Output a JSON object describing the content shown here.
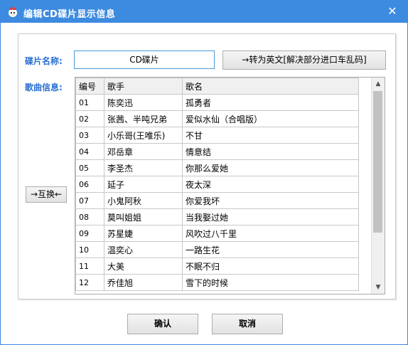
{
  "window": {
    "title": "编辑CD碟片显示信息",
    "close_symbol": "✕",
    "accent": "#3d8be0"
  },
  "form": {
    "name_label": "碟片名称:",
    "name_value": "CD碟片",
    "convert_button": "→转为英文[解决部分进口车乱码]",
    "songs_label": "歌曲信息:",
    "swap_button": "→互换←"
  },
  "table": {
    "headers": [
      "编号",
      "歌手",
      "歌名"
    ],
    "rows": [
      [
        "01",
        "陈奕迅",
        "孤勇者"
      ],
      [
        "02",
        "张茜、半吨兄弟",
        "爱似水仙（合唱版）"
      ],
      [
        "03",
        "小乐哥(王唯乐)",
        "不甘"
      ],
      [
        "04",
        "邓岳章",
        "情意结"
      ],
      [
        "05",
        "李圣杰",
        "你那么爱她"
      ],
      [
        "06",
        "延子",
        "夜太深"
      ],
      [
        "07",
        "小鬼阿秋",
        "你爱我坏"
      ],
      [
        "08",
        "莫叫姐姐",
        "当我娶过她"
      ],
      [
        "09",
        "苏星婕",
        "风吹过八千里"
      ],
      [
        "10",
        "温奕心",
        "一路生花"
      ],
      [
        "11",
        "大美",
        "不眠不归"
      ],
      [
        "12",
        "乔佳旭",
        "雪下的时候"
      ]
    ]
  },
  "footer": {
    "ok": "确认",
    "cancel": "取消"
  }
}
